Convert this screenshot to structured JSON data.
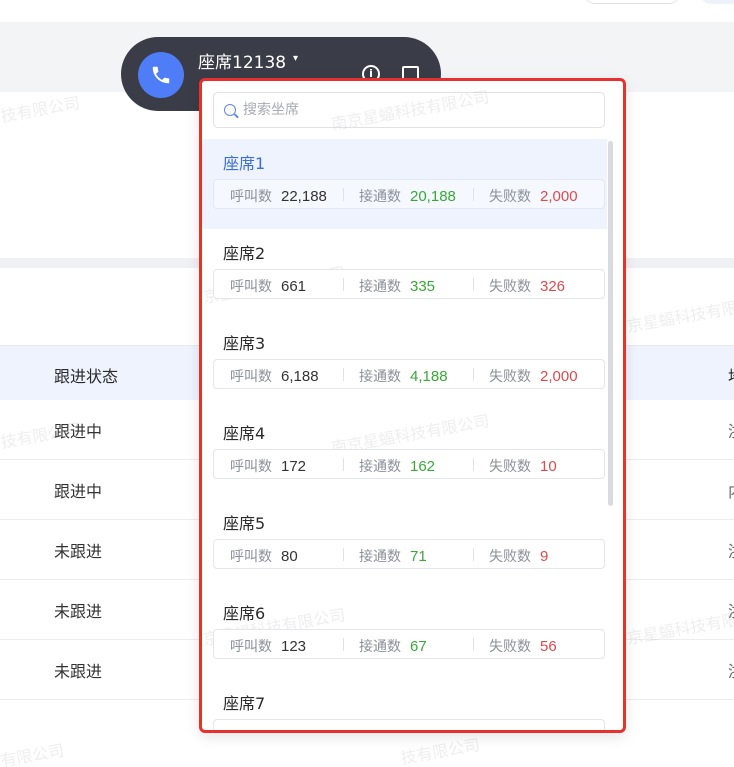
{
  "call_bar": {
    "agent_title": "座席12138",
    "caret": "▾",
    "info_glyph": "i"
  },
  "search": {
    "placeholder": "搜索坐席"
  },
  "stat_labels": {
    "calls": "呼叫数",
    "connected": "接通数",
    "failed": "失败数"
  },
  "agents": [
    {
      "name": "座席1",
      "calls": "22,188",
      "connected": "20,188",
      "failed": "2,000"
    },
    {
      "name": "座席2",
      "calls": "661",
      "connected": "335",
      "failed": "326"
    },
    {
      "name": "座席3",
      "calls": "6,188",
      "connected": "4,188",
      "failed": "2,000"
    },
    {
      "name": "座席4",
      "calls": "172",
      "connected": "162",
      "failed": "10"
    },
    {
      "name": "座席5",
      "calls": "80",
      "connected": "71",
      "failed": "9"
    },
    {
      "name": "座席6",
      "calls": "123",
      "connected": "67",
      "failed": "56"
    },
    {
      "name": "座席7",
      "calls": "",
      "connected": "",
      "failed": ""
    }
  ],
  "table": {
    "header": {
      "status": "跟进状态",
      "right_col_partial": "地"
    },
    "rows": [
      {
        "status": "跟进中",
        "right_partial": "浙"
      },
      {
        "status": "跟进中",
        "right_partial": "内"
      },
      {
        "status": "未跟进",
        "right_partial": "浙"
      },
      {
        "status": "未跟进",
        "right_partial": "浙"
      },
      {
        "status": "未跟进",
        "right_partial": "浙"
      }
    ]
  },
  "watermark": {
    "full": "南京星蝠科技有限公司",
    "partial_a": "技有限公司",
    "partial_b": "有限公司"
  },
  "colors": {
    "accent": "#4f7cf7",
    "selected_text": "#3d6fdc",
    "connected": "#3aa838",
    "failed": "#e04a4a",
    "highlight_border": "#e8302f"
  }
}
